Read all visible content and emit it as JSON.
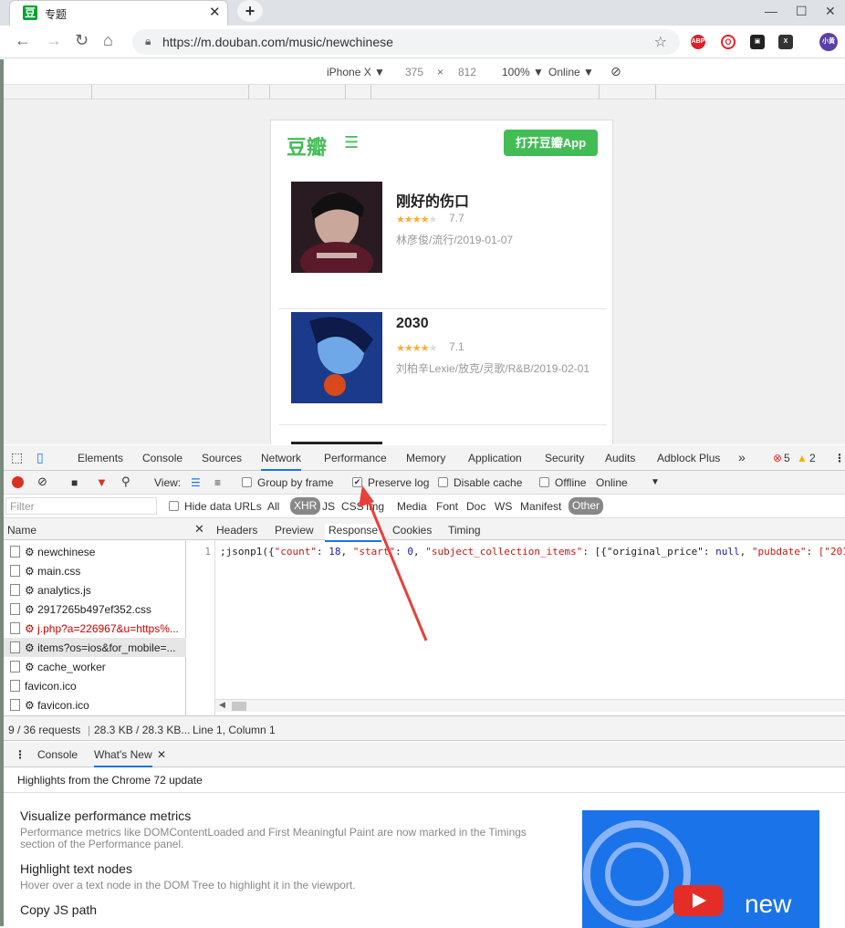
{
  "browser": {
    "tab_title": "专题",
    "tab_favicon": "豆",
    "url": "https://m.douban.com/music/newchinese",
    "profile_label": "小黄",
    "extensions": [
      "ABP",
      "O",
      "▣",
      "X"
    ]
  },
  "device_toolbar": {
    "device": "iPhone X ▼",
    "width": "375",
    "sep": "×",
    "height": "812",
    "zoom": "100% ▼",
    "network": "Online ▼"
  },
  "page": {
    "logo": "豆瓣",
    "open_app": "打开豆瓣App",
    "albums": [
      {
        "title": "刚好的伤口",
        "rating": "7.7",
        "stars": 4,
        "info": "林彦俊/流行/2019-01-07"
      },
      {
        "title": "2030",
        "rating": "7.1",
        "stars": 4,
        "info": "刘柏辛Lexie/放克/灵歌/R&B/2019-02-01"
      }
    ]
  },
  "devtools": {
    "tabs": [
      "Elements",
      "Console",
      "Sources",
      "Network",
      "Performance",
      "Memory",
      "Application",
      "Security",
      "Audits",
      "Adblock Plus"
    ],
    "active_tab": "Network",
    "errors": "5",
    "warnings": "2",
    "more": "»",
    "toolbar": {
      "view": "View:",
      "group_by_frame": "Group by frame",
      "preserve_log": "Preserve log",
      "disable_cache": "Disable cache",
      "offline": "Offline",
      "online": "Online"
    },
    "filter": {
      "placeholder": "Filter",
      "hide_data_urls": "Hide data URLs",
      "types": [
        "All",
        "XHR",
        "JS",
        "CSS",
        "Img",
        "Media",
        "Font",
        "Doc",
        "WS",
        "Manifest",
        "Other"
      ]
    },
    "name_header": "Name",
    "requests": [
      {
        "name": "⚙ newchinese",
        "state": "normal"
      },
      {
        "name": "⚙ main.css",
        "state": "normal"
      },
      {
        "name": "⚙ analytics.js",
        "state": "normal"
      },
      {
        "name": "⚙ 2917265b497ef352.css",
        "state": "normal"
      },
      {
        "name": "⚙ j.php?a=226967&u=https%...",
        "state": "error"
      },
      {
        "name": "⚙ items?os=ios&for_mobile=...",
        "state": "selected"
      },
      {
        "name": "⚙ cache_worker",
        "state": "normal"
      },
      {
        "name": "favicon.ico",
        "state": "normal"
      },
      {
        "name": "⚙ favicon.ico",
        "state": "normal"
      }
    ],
    "detail_tabs": [
      "Headers",
      "Preview",
      "Response",
      "Cookies",
      "Timing"
    ],
    "active_detail_tab": "Response",
    "response": {
      "line_no": "1",
      "prefix": ";jsonp1({",
      "k_count": "\"count\"",
      "v_count": "18",
      "k_start": "\"start\"",
      "v_start": "0",
      "k_items": "\"subject_collection_items\"",
      "k_price": "[{\"original_price\"",
      "v_price": "null",
      "k_pubdate": "\"pubdate\"",
      "v_pubdate": "[\"201"
    },
    "status": {
      "requests": "9 / 36 requests",
      "size": "28.3 KB / 28.3 KB...",
      "position": "Line 1, Column 1"
    },
    "drawer_tabs": [
      "Console",
      "What's New"
    ],
    "highlights": "Highlights from the Chrome 72 update",
    "whats_new": [
      {
        "title": "Visualize performance metrics",
        "desc": "Performance metrics like DOMContentLoaded and First Meaningful Paint are now marked in the Timings section of the Performance panel."
      },
      {
        "title": "Highlight text nodes",
        "desc": "Hover over a text node in the DOM Tree to highlight it in the viewport."
      },
      {
        "title": "Copy JS path",
        "desc": ""
      }
    ],
    "promo_text": "new"
  },
  "colors": {
    "douban_green": "#42bd56",
    "devtools_blue": "#1a73e8",
    "arrow_red": "#e8403a"
  }
}
